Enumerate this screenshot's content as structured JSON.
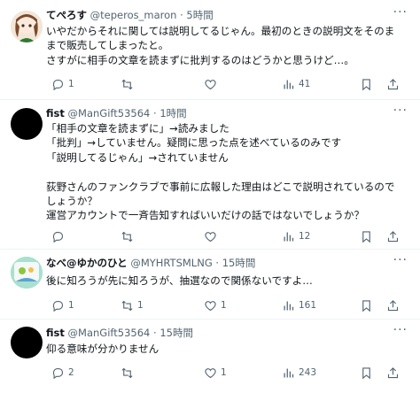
{
  "tweets": [
    {
      "name": "てぺろす",
      "handle": "@teperos_maron",
      "time": "5時間",
      "lines": [
        "いやだからそれに関しては説明してるじゃん。最初のときの説明文をそのま",
        "まで販売してしまったと。",
        "さすがに相手の文章を読まずに批判するのはどうかと思うけど…。"
      ],
      "replies": "1",
      "retweets": "",
      "likes": "",
      "views": "41"
    },
    {
      "name": "fist",
      "handle": "@ManGift53564",
      "time": "1時間",
      "lines": [
        "「相手の文章を読まずに」→読みました",
        "「批判」→していません。疑問に思った点を述べているのみです",
        "「説明してるじゃん」→されていません",
        "",
        "荻野さんのファンクラブで事前に広報した理由はどこで説明されているので",
        "しょうか？",
        "運営アカウントで一斉告知すればいいだけの話ではないでしょうか？"
      ],
      "replies": "",
      "retweets": "",
      "likes": "",
      "views": "12"
    },
    {
      "name": "なべ@ゆかのひと",
      "handle": "@MYHRTSMLNG",
      "time": "15時間",
      "lines": [
        "後に知ろうが先に知ろうが、抽選なので関係ないですよ…"
      ],
      "replies": "1",
      "retweets": "1",
      "likes": "1",
      "views": "161"
    },
    {
      "name": "fist",
      "handle": "@ManGift53564",
      "time": "15時間",
      "lines": [
        "仰る意味が分かりません"
      ],
      "replies": "2",
      "retweets": "",
      "likes": "1",
      "views": "243"
    }
  ],
  "icons": {
    "reply": "reply-icon",
    "retweet": "retweet-icon",
    "like": "heart-icon",
    "views": "views-icon",
    "bookmark": "bookmark-icon",
    "share": "share-icon",
    "more": "more-icon"
  },
  "colors": {
    "text": "#0f1419",
    "secondary": "#536471",
    "divider": "#eff3f4"
  }
}
